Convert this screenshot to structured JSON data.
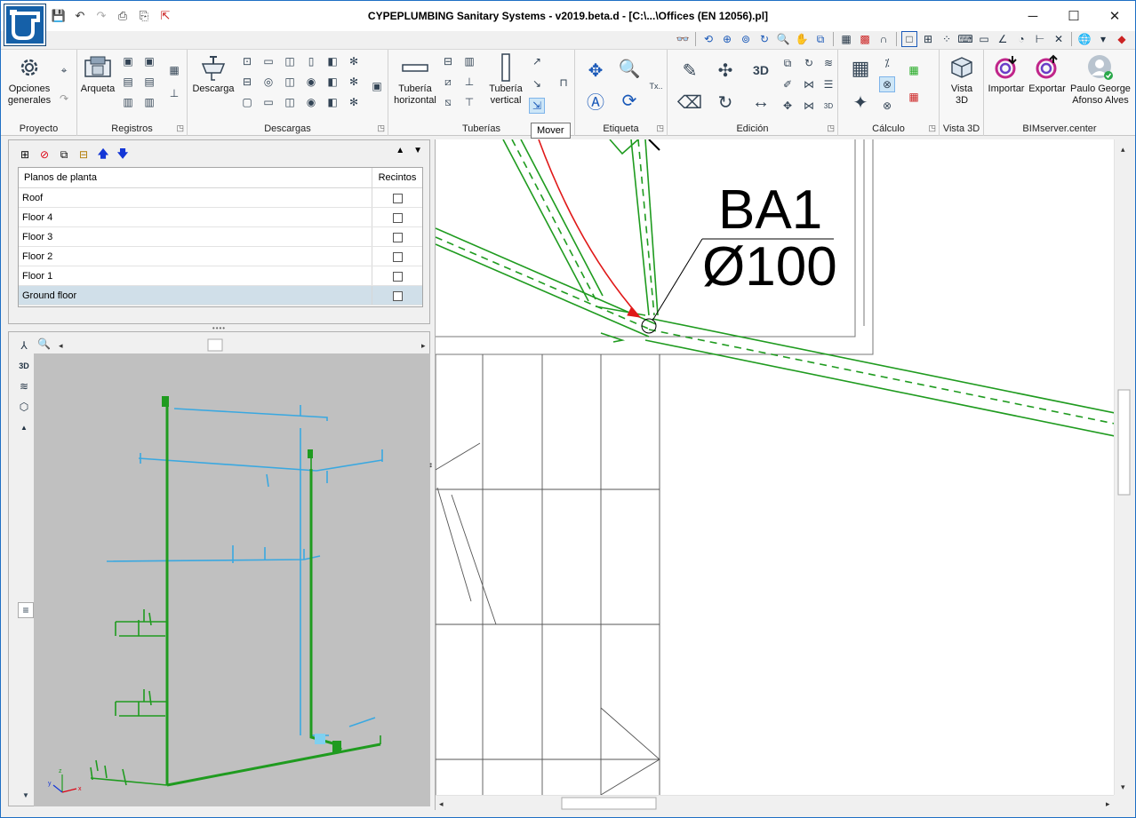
{
  "titlebar": {
    "title": "CYPEPLUMBING Sanitary Systems - v2019.beta.d - [C:\\...\\Offices (EN 12056).pl]",
    "minimize": "─",
    "maximize": "☐",
    "close": "✕"
  },
  "ribbon": {
    "proyecto": {
      "label": "Proyecto",
      "opciones": "Opciones\ngenerales"
    },
    "registros": {
      "label": "Registros",
      "arqueta": "Arqueta"
    },
    "descargas": {
      "label": "Descargas",
      "descarga": "Descarga"
    },
    "tuberias": {
      "label": "Tuberías",
      "horizontal": "Tubería\nhorizontal",
      "vertical": "Tubería\nvertical"
    },
    "etiqueta": {
      "label": "Etiqueta"
    },
    "edicion": {
      "label": "Edición"
    },
    "calculo": {
      "label": "Cálculo"
    },
    "vista3d": {
      "label": "Vista 3D",
      "button": "Vista\n3D"
    },
    "bimserver": {
      "label": "BIMserver.center",
      "importar": "Importar",
      "exportar": "Exportar",
      "user": "Paulo George\nAfonso Alves"
    }
  },
  "tooltip": {
    "text": "Mover"
  },
  "floors": {
    "col_plans": "Planos de planta",
    "col_rooms": "Recintos",
    "rows": [
      {
        "name": "Roof",
        "selected": false
      },
      {
        "name": "Floor 4",
        "selected": false
      },
      {
        "name": "Floor 3",
        "selected": false
      },
      {
        "name": "Floor 2",
        "selected": false
      },
      {
        "name": "Floor 1",
        "selected": false
      },
      {
        "name": "Ground floor",
        "selected": true
      }
    ]
  },
  "drawing": {
    "pipe_label": "BA1",
    "pipe_diameter": "Ø100"
  },
  "colors": {
    "pipe_green": "#1f9b1f",
    "pipe_blue": "#3aa8e0",
    "arrow_red": "#e01818",
    "selection": "#d0dfe9"
  }
}
